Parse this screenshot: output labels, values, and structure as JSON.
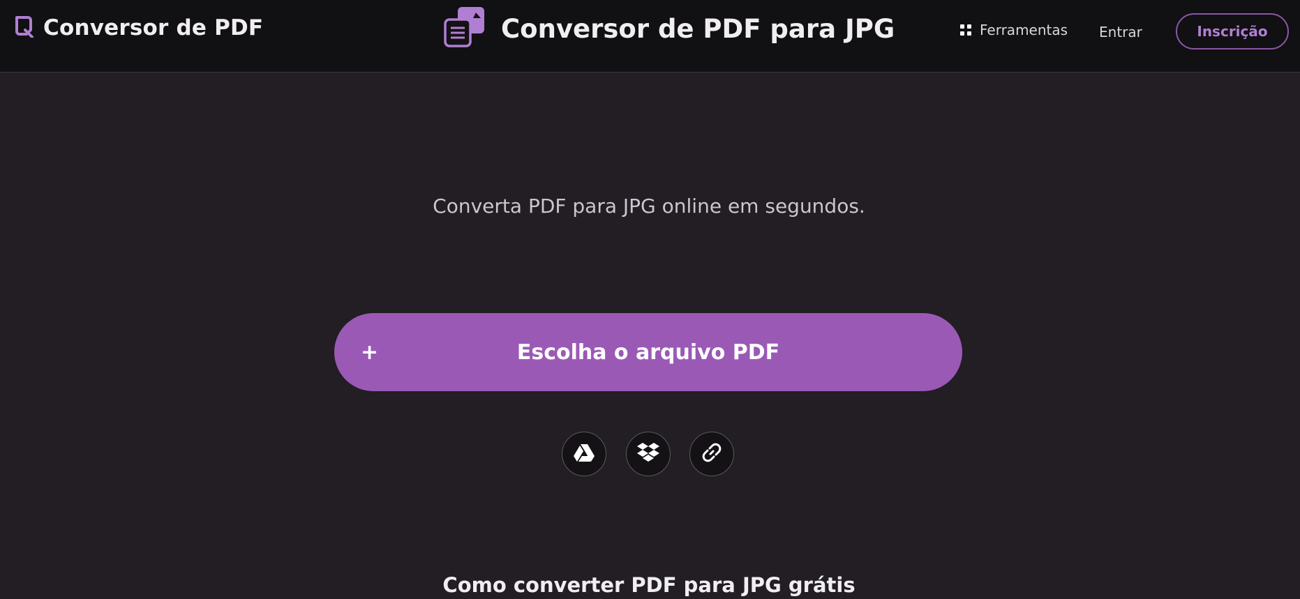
{
  "header": {
    "brand_name": "Conversor de PDF",
    "page_title": "Conversor de PDF para JPG",
    "tools_label": "Ferramentas",
    "login_label": "Entrar",
    "signup_label": "Inscrição"
  },
  "main": {
    "subtitle": "Converta PDF para JPG online em segundos.",
    "upload_plus": "+",
    "upload_label": "Escolha o arquivo PDF",
    "sources": [
      {
        "icon": "google-drive-icon"
      },
      {
        "icon": "dropbox-icon"
      },
      {
        "icon": "link-icon"
      }
    ],
    "how_to_heading": "Como converter PDF para JPG grátis"
  },
  "colors": {
    "accent": "#9b59b6",
    "accent_text": "#b07fd4",
    "background": "#221e24",
    "topbar": "#111012"
  }
}
